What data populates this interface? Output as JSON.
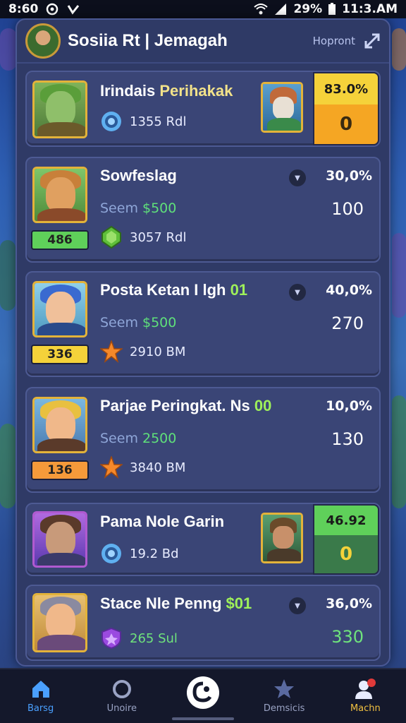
{
  "status_bar": {
    "time": "8:60",
    "battery": "29%",
    "clock": "11:3.AM"
  },
  "header": {
    "title": "Sosiia Rt | Jemagah",
    "button_label": "Hopront"
  },
  "cards": [
    {
      "name_prefix": "Irindais ",
      "name_highlight": "Perihakak",
      "stat": "1355 Rdl",
      "score_top": "83.0%",
      "score_bot": "0"
    },
    {
      "name": "Sowfeslag",
      "seem_prefix": "Seem ",
      "seem_value": "$500",
      "rank": "486",
      "stat": "3057 Rdl",
      "pct": "30,0%",
      "score": "100"
    },
    {
      "name": "Posta Ketan I lgh ",
      "name_highlight": "01",
      "seem_prefix": "Seem ",
      "seem_value": "$500",
      "rank": "336",
      "stat": "2910 BM",
      "pct": "40,0%",
      "score": "270"
    },
    {
      "name": "Parjae Peringkat. Ns ",
      "name_highlight": "00",
      "seem_prefix": "Seem ",
      "seem_value": "2500",
      "rank": "136",
      "stat": "3840 BM",
      "pct": "10,0%",
      "score": "130"
    },
    {
      "name": "Pama Nole Garin",
      "stat": "19.2 Bd",
      "score_top": "46.92",
      "score_bot": "0"
    },
    {
      "name": "Stace Nle Penng ",
      "name_highlight": "$01",
      "stat": "265 Sul",
      "pct": "36,0%",
      "score": "330"
    }
  ],
  "bottom_nav": [
    {
      "label": "Barsg"
    },
    {
      "label": "Unoire"
    },
    {
      "label": ""
    },
    {
      "label": "Demsicis"
    },
    {
      "label": "Machn"
    }
  ],
  "colors": {
    "accent": "#4aa0ff",
    "gold": "#e3b33a",
    "green": "#6fe37c",
    "orange": "#f5a623",
    "panel": "#2f3a66"
  }
}
